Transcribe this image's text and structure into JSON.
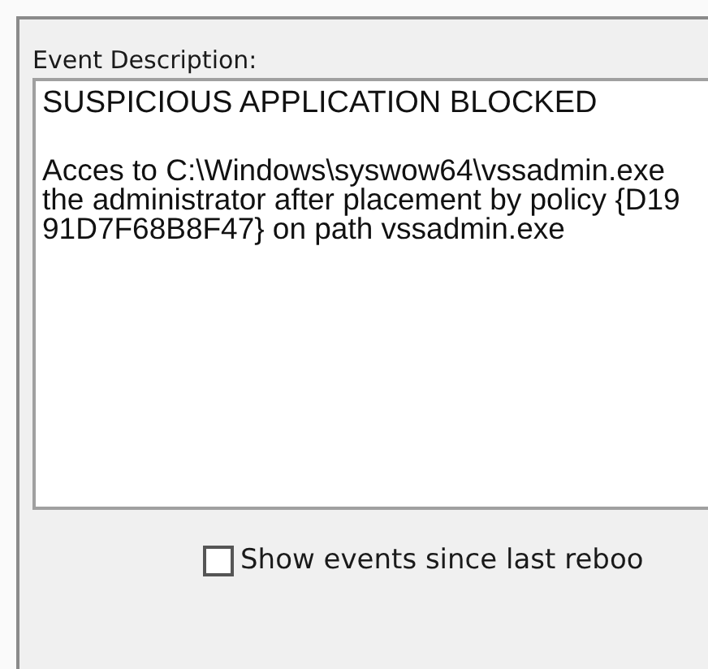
{
  "event_description": {
    "label": "Event Description:",
    "heading": "SUSPICIOUS APPLICATION BLOCKED",
    "lines": [
      "Acces to C:\\Windows\\syswow64\\vssadmin.exe",
      "the administrator after placement by policy {D19",
      "91D7F68B8F47} on path vssadmin.exe"
    ]
  },
  "show_events_checkbox": {
    "label": "Show events since last reboo",
    "checked": false
  }
}
